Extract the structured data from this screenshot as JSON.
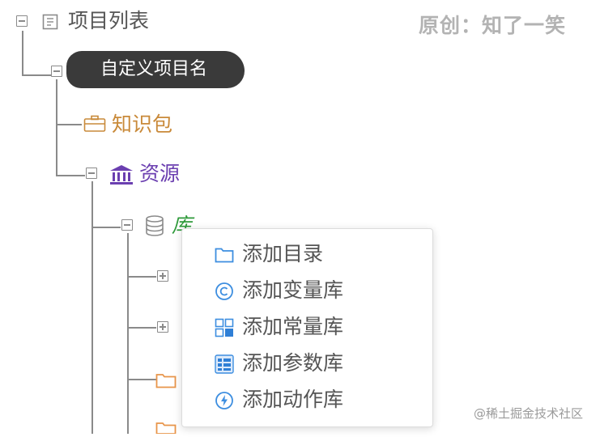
{
  "watermark": "原创：知了一笑",
  "footer_watermark": "@稀土掘金技术社区",
  "tree": {
    "root_label": "项目列表",
    "custom_project_label": "自定义项目名",
    "knowledge_pack_label": "知识包",
    "resources_label": "资源",
    "library_label": "库"
  },
  "context_menu": {
    "items": [
      {
        "label": "添加目录",
        "icon": "folder-icon"
      },
      {
        "label": "添加变量库",
        "icon": "copyright-circle-icon"
      },
      {
        "label": "添加常量库",
        "icon": "grid-blocks-icon"
      },
      {
        "label": "添加参数库",
        "icon": "list-table-icon"
      },
      {
        "label": "添加动作库",
        "icon": "lightning-circle-icon"
      }
    ]
  },
  "colors": {
    "tree_line": "#8a8a8a",
    "knowledge_pack": "#c98a3a",
    "resources": "#6b3fb0",
    "library": "#2e9a3a",
    "menu_icon": "#3d8ee0",
    "folder_orange": "#e8954a"
  }
}
